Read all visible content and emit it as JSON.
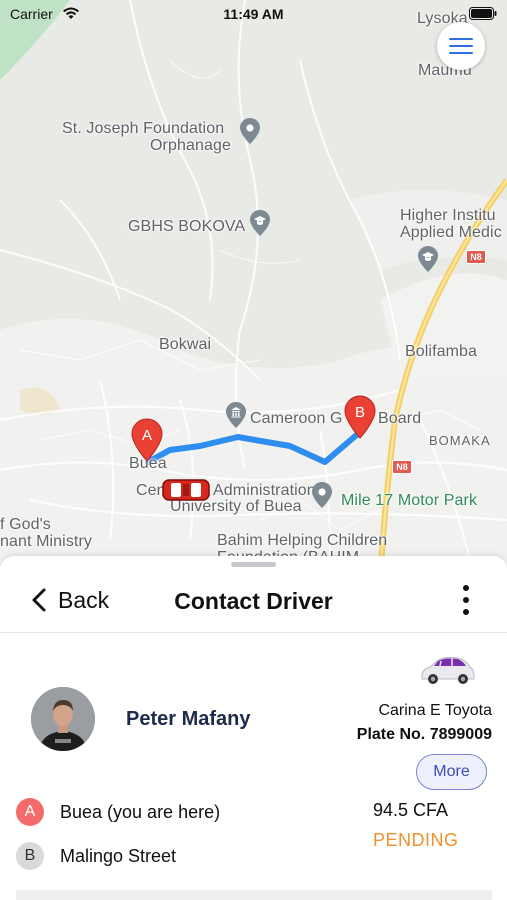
{
  "status_bar": {
    "carrier": "Carrier",
    "time": "11:49 AM"
  },
  "map": {
    "labels": {
      "lysoka": "Lysoka",
      "maumu": "Maumu",
      "st_joseph_1": "St. Joseph Foundation",
      "st_joseph_2": "Orphanage",
      "gbhs": "GBHS BOKOVA",
      "higher_inst_1": "Higher Institu",
      "higher_inst_2": "Applied Medic",
      "n8_top": "N8",
      "bokwai": "Bokwai",
      "bolifamba": "Bolifamba",
      "cameroon_gas": "Cameroon G",
      "cameroon_gas_tail": "Board",
      "bomaka": "BOMAKA",
      "buea": "Buea",
      "n8_bottom": "N8",
      "central_admin_1": "Cen",
      "central_admin_2": "Administration",
      "univ_buea": "University of Buea",
      "mile17": "Mile 17 Motor Park",
      "gods_1": "f God's",
      "gods_2": "nant Ministry",
      "bahim_1": "Bahim Helping Children",
      "bahim_2": "Foundation (BAHIM"
    },
    "markers": {
      "origin": "A",
      "destination": "B"
    },
    "route_color": "#2f8df0"
  },
  "sheet": {
    "back_label": "Back",
    "title": "Contact Driver"
  },
  "driver": {
    "name": "Peter Mafany",
    "vehicle_model": "Carina E Toyota",
    "plate_label": "Plate No.",
    "plate_number": "7899009",
    "more_button": "More"
  },
  "trip": {
    "stops": [
      {
        "badge": "A",
        "label": "Buea (you are here)"
      },
      {
        "badge": "B",
        "label": "Malingo Street"
      }
    ],
    "fare": "94.5 CFA",
    "status": "PENDING"
  },
  "colors": {
    "accent": "#2f6fe0",
    "status_pending": "#f0902e",
    "marker_red": "#e94235",
    "title_navy": "#1e2a4a"
  }
}
